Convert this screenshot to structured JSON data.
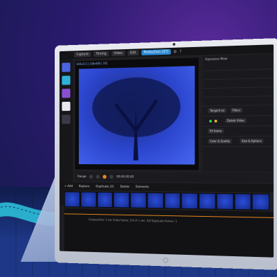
{
  "app": {
    "tabs": [
      {
        "label": "Capture"
      },
      {
        "label": "Timing"
      },
      {
        "label": "Video"
      },
      {
        "label": "Edit"
      },
      {
        "label": "Production (37)",
        "active": true
      }
    ],
    "preview_label": "640x213 | 358x480 | 1K5",
    "right_panel_title": "Expression Mixer",
    "right_buttons": [
      "Tangent on",
      "Filters",
      "Delete Video",
      "Fit frame",
      "Color & Quality",
      "Size & Options"
    ],
    "transport_text": "Range",
    "timecode": "00:00:00:00",
    "toolbar2": [
      "Add",
      "Replace",
      "Duplicate (2)",
      "Delete",
      "Elements"
    ],
    "timeline_footer": "Composition: 5 sec    Video frame: 1/4 of  >  sec: 5/4    Duplicate frames: 1"
  },
  "colors": {
    "accent_blue": "#2a8ad6",
    "accent_orange": "#e8891c"
  }
}
